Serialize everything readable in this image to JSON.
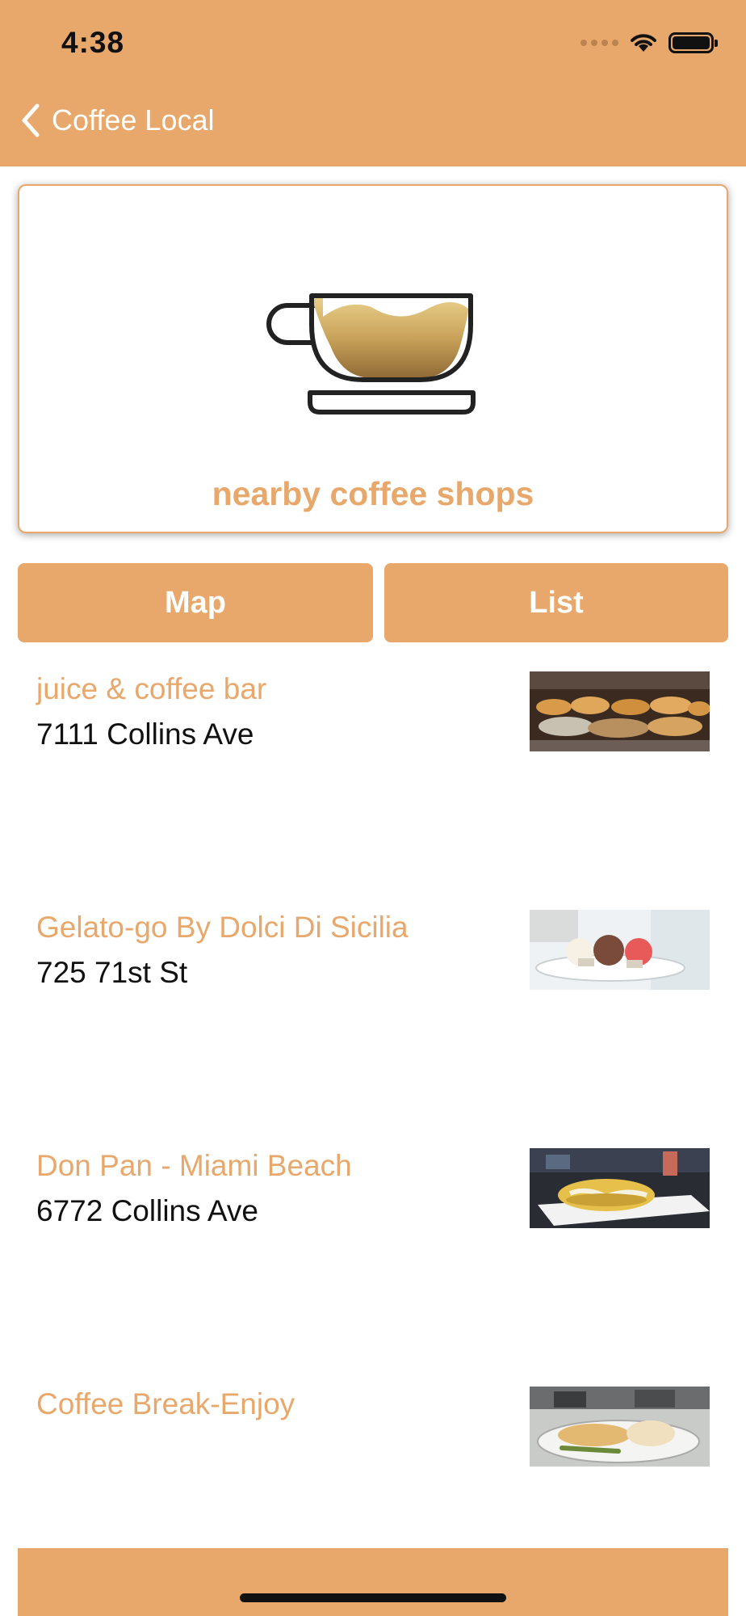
{
  "status": {
    "time": "4:38"
  },
  "nav": {
    "back_label": "Coffee Local"
  },
  "hero": {
    "caption": "nearby coffee shops"
  },
  "segments": {
    "map_label": "Map",
    "list_label": "List"
  },
  "colors": {
    "accent": "#E8A86C",
    "text": "#111111"
  },
  "shops": [
    {
      "name": "juice & coffee bar",
      "address": "7111 Collins Ave",
      "thumb": "pastries-photo"
    },
    {
      "name": "Gelato-go By Dolci Di Sicilia",
      "address": "725 71st St",
      "thumb": "gelato-photo"
    },
    {
      "name": "Don Pan - Miami Beach",
      "address": "6772 Collins Ave",
      "thumb": "arepa-photo"
    },
    {
      "name": "Coffee Break-Enjoy",
      "address": "",
      "thumb": "breakfast-photo"
    }
  ]
}
